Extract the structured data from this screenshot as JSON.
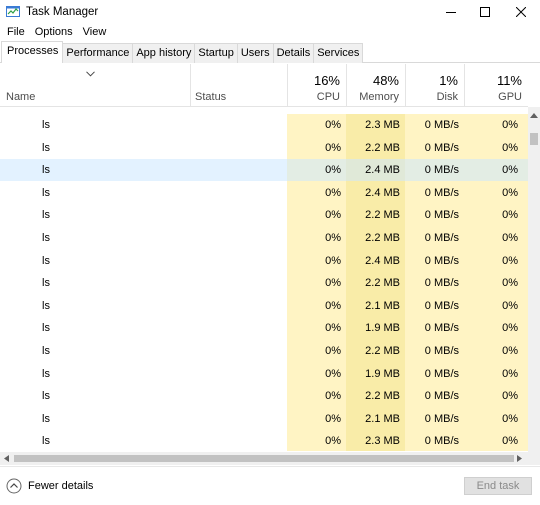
{
  "window": {
    "title": "Task Manager"
  },
  "menu": [
    "File",
    "Options",
    "View"
  ],
  "tabs": [
    "Processes",
    "Performance",
    "App history",
    "Startup",
    "Users",
    "Details",
    "Services"
  ],
  "active_tab": "Processes",
  "columns": {
    "name": "Name",
    "status": "Status",
    "cpu": {
      "percent": "16%",
      "label": "CPU"
    },
    "memory": {
      "percent": "48%",
      "label": "Memory"
    },
    "disk": {
      "percent": "1%",
      "label": "Disk"
    },
    "gpu": {
      "percent": "11%",
      "label": "GPU"
    }
  },
  "rows": [
    {
      "name": "ls",
      "cpu": "0%",
      "memory": "2.3 MB",
      "disk": "0 MB/s",
      "gpu": "0%"
    },
    {
      "name": "ls",
      "cpu": "0%",
      "memory": "2.2 MB",
      "disk": "0 MB/s",
      "gpu": "0%"
    },
    {
      "name": "ls",
      "cpu": "0%",
      "memory": "2.4 MB",
      "disk": "0 MB/s",
      "gpu": "0%"
    },
    {
      "name": "ls",
      "cpu": "0%",
      "memory": "2.4 MB",
      "disk": "0 MB/s",
      "gpu": "0%"
    },
    {
      "name": "ls",
      "cpu": "0%",
      "memory": "2.2 MB",
      "disk": "0 MB/s",
      "gpu": "0%"
    },
    {
      "name": "ls",
      "cpu": "0%",
      "memory": "2.2 MB",
      "disk": "0 MB/s",
      "gpu": "0%"
    },
    {
      "name": "ls",
      "cpu": "0%",
      "memory": "2.4 MB",
      "disk": "0 MB/s",
      "gpu": "0%"
    },
    {
      "name": "ls",
      "cpu": "0%",
      "memory": "2.2 MB",
      "disk": "0 MB/s",
      "gpu": "0%"
    },
    {
      "name": "ls",
      "cpu": "0%",
      "memory": "2.1 MB",
      "disk": "0 MB/s",
      "gpu": "0%"
    },
    {
      "name": "ls",
      "cpu": "0%",
      "memory": "1.9 MB",
      "disk": "0 MB/s",
      "gpu": "0%"
    },
    {
      "name": "ls",
      "cpu": "0%",
      "memory": "2.2 MB",
      "disk": "0 MB/s",
      "gpu": "0%"
    },
    {
      "name": "ls",
      "cpu": "0%",
      "memory": "1.9 MB",
      "disk": "0 MB/s",
      "gpu": "0%"
    },
    {
      "name": "ls",
      "cpu": "0%",
      "memory": "2.2 MB",
      "disk": "0 MB/s",
      "gpu": "0%"
    },
    {
      "name": "ls",
      "cpu": "0%",
      "memory": "2.1 MB",
      "disk": "0 MB/s",
      "gpu": "0%"
    },
    {
      "name": "ls",
      "cpu": "0%",
      "memory": "2.3 MB",
      "disk": "0 MB/s",
      "gpu": "0%"
    }
  ],
  "selected_row": 2,
  "footer": {
    "fewer_details": "Fewer details",
    "end_task": "End task"
  },
  "colors": {
    "heat_light": "#fff4c4",
    "heat_medium": "#f9eca8",
    "selection": "#cce8ff"
  },
  "icons": [
    "task-manager-app-icon",
    "minimize-icon",
    "maximize-icon",
    "close-icon",
    "sort-chevron-icon",
    "collapse-up-icon",
    "scroll-left-arrow-icon",
    "scroll-right-arrow-icon",
    "scroll-up-arrow-icon"
  ]
}
